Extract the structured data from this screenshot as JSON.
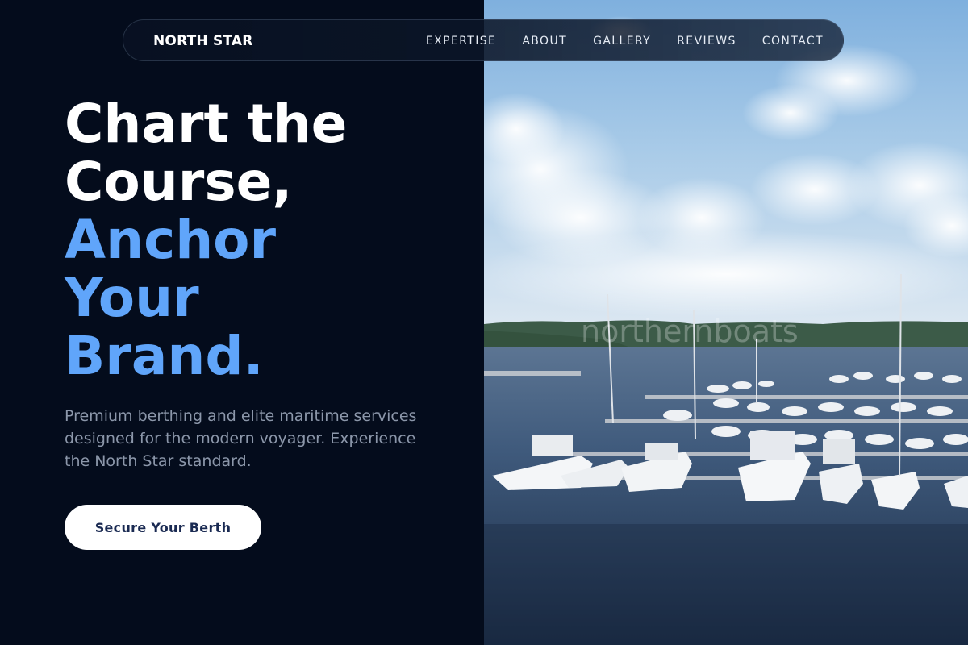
{
  "nav": {
    "brand": "NORTH STAR",
    "links": [
      "EXPERTISE",
      "ABOUT",
      "GALLERY",
      "REVIEWS",
      "CONTACT"
    ]
  },
  "hero": {
    "title_lines": [
      "Chart the",
      "Course,"
    ],
    "accent_lines": [
      "Anchor",
      "Your",
      "Brand."
    ],
    "subtitle": "Premium berthing and elite maritime services designed for the modern voyager. Experience the North Star standard.",
    "cta_label": "Secure Your Berth"
  },
  "photo": {
    "watermark": "northernboats"
  },
  "colors": {
    "background": "#040c1c",
    "accent": "#60a5fa",
    "subtitle": "#8c97aa",
    "cta_text": "#1a2a52"
  }
}
